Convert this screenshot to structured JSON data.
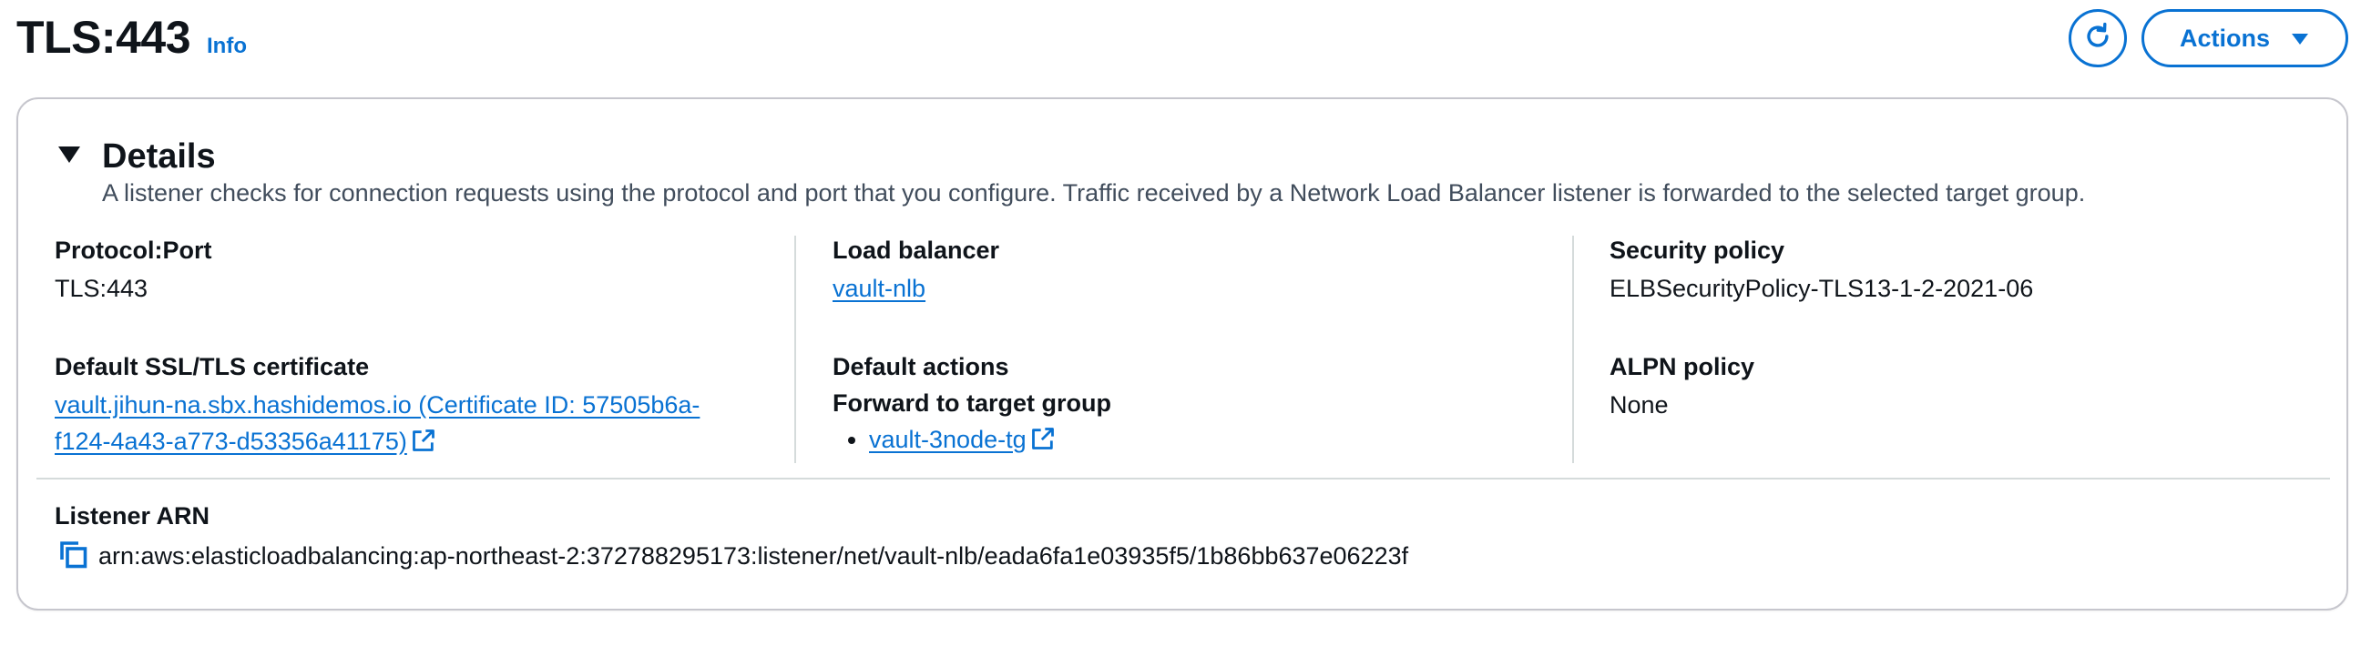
{
  "header": {
    "title": "TLS:443",
    "info_label": "Info",
    "actions_label": "Actions"
  },
  "details": {
    "heading": "Details",
    "description": "A listener checks for connection requests using the protocol and port that you configure. Traffic received by a Network Load Balancer listener is forwarded to the selected target group.",
    "protocol_port": {
      "label": "Protocol:Port",
      "value": "TLS:443"
    },
    "certificate": {
      "label": "Default SSL/TLS certificate",
      "value_line1": "vault.jihun-na.sbx.hashidemos.io (Certificate ID: 57505b6a-",
      "value_line2": "f124-4a43-a773-d53356a41175)"
    },
    "load_balancer": {
      "label": "Load balancer",
      "value": "vault-nlb"
    },
    "default_actions": {
      "label": "Default actions",
      "sub_label": "Forward to target group",
      "target_groups": [
        "vault-3node-tg"
      ]
    },
    "security_policy": {
      "label": "Security policy",
      "value": "ELBSecurityPolicy-TLS13-1-2-2021-06"
    },
    "alpn_policy": {
      "label": "ALPN policy",
      "value": "None"
    },
    "listener_arn": {
      "label": "Listener ARN",
      "value": "arn:aws:elasticloadbalancing:ap-northeast-2:372788295173:listener/net/vault-nlb/eada6fa1e03935f5/1b86bb637e06223f"
    }
  },
  "icons": {
    "refresh": "refresh-icon",
    "caret_down": "caret-down-icon",
    "collapse": "triangle-down-icon",
    "external": "external-link-icon",
    "copy": "copy-icon"
  },
  "colors": {
    "accent": "#0972d3",
    "text": "#0f141a",
    "secondary_text": "#414d5c",
    "border": "#c6c6cd",
    "divider": "#d5dbdb"
  }
}
